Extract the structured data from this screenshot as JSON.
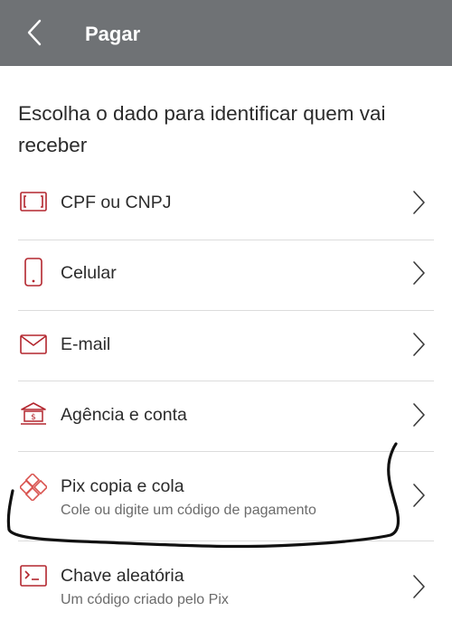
{
  "header": {
    "title": "Pagar",
    "back_icon": "chevron-left-icon"
  },
  "prompt": "Escolha o dado para identificar quem vai receber",
  "options": [
    {
      "label": "CPF ou CNPJ",
      "sub": "",
      "icon": "document-id-icon"
    },
    {
      "label": "Celular",
      "sub": "",
      "icon": "smartphone-icon"
    },
    {
      "label": "E-mail",
      "sub": "",
      "icon": "envelope-icon"
    },
    {
      "label": "Agência e conta",
      "sub": "",
      "icon": "bank-icon"
    },
    {
      "label": "Pix copia e cola",
      "sub": "Cole ou digite um código de pagamento",
      "icon": "pix-icon"
    },
    {
      "label": "Chave aleatória",
      "sub": "Um código criado pelo Pix",
      "icon": "terminal-icon"
    }
  ],
  "colors": {
    "header_bg": "#6f7275",
    "accent": "#b3262e",
    "text": "#2b2b2b",
    "subtext": "#6b6b6b"
  }
}
